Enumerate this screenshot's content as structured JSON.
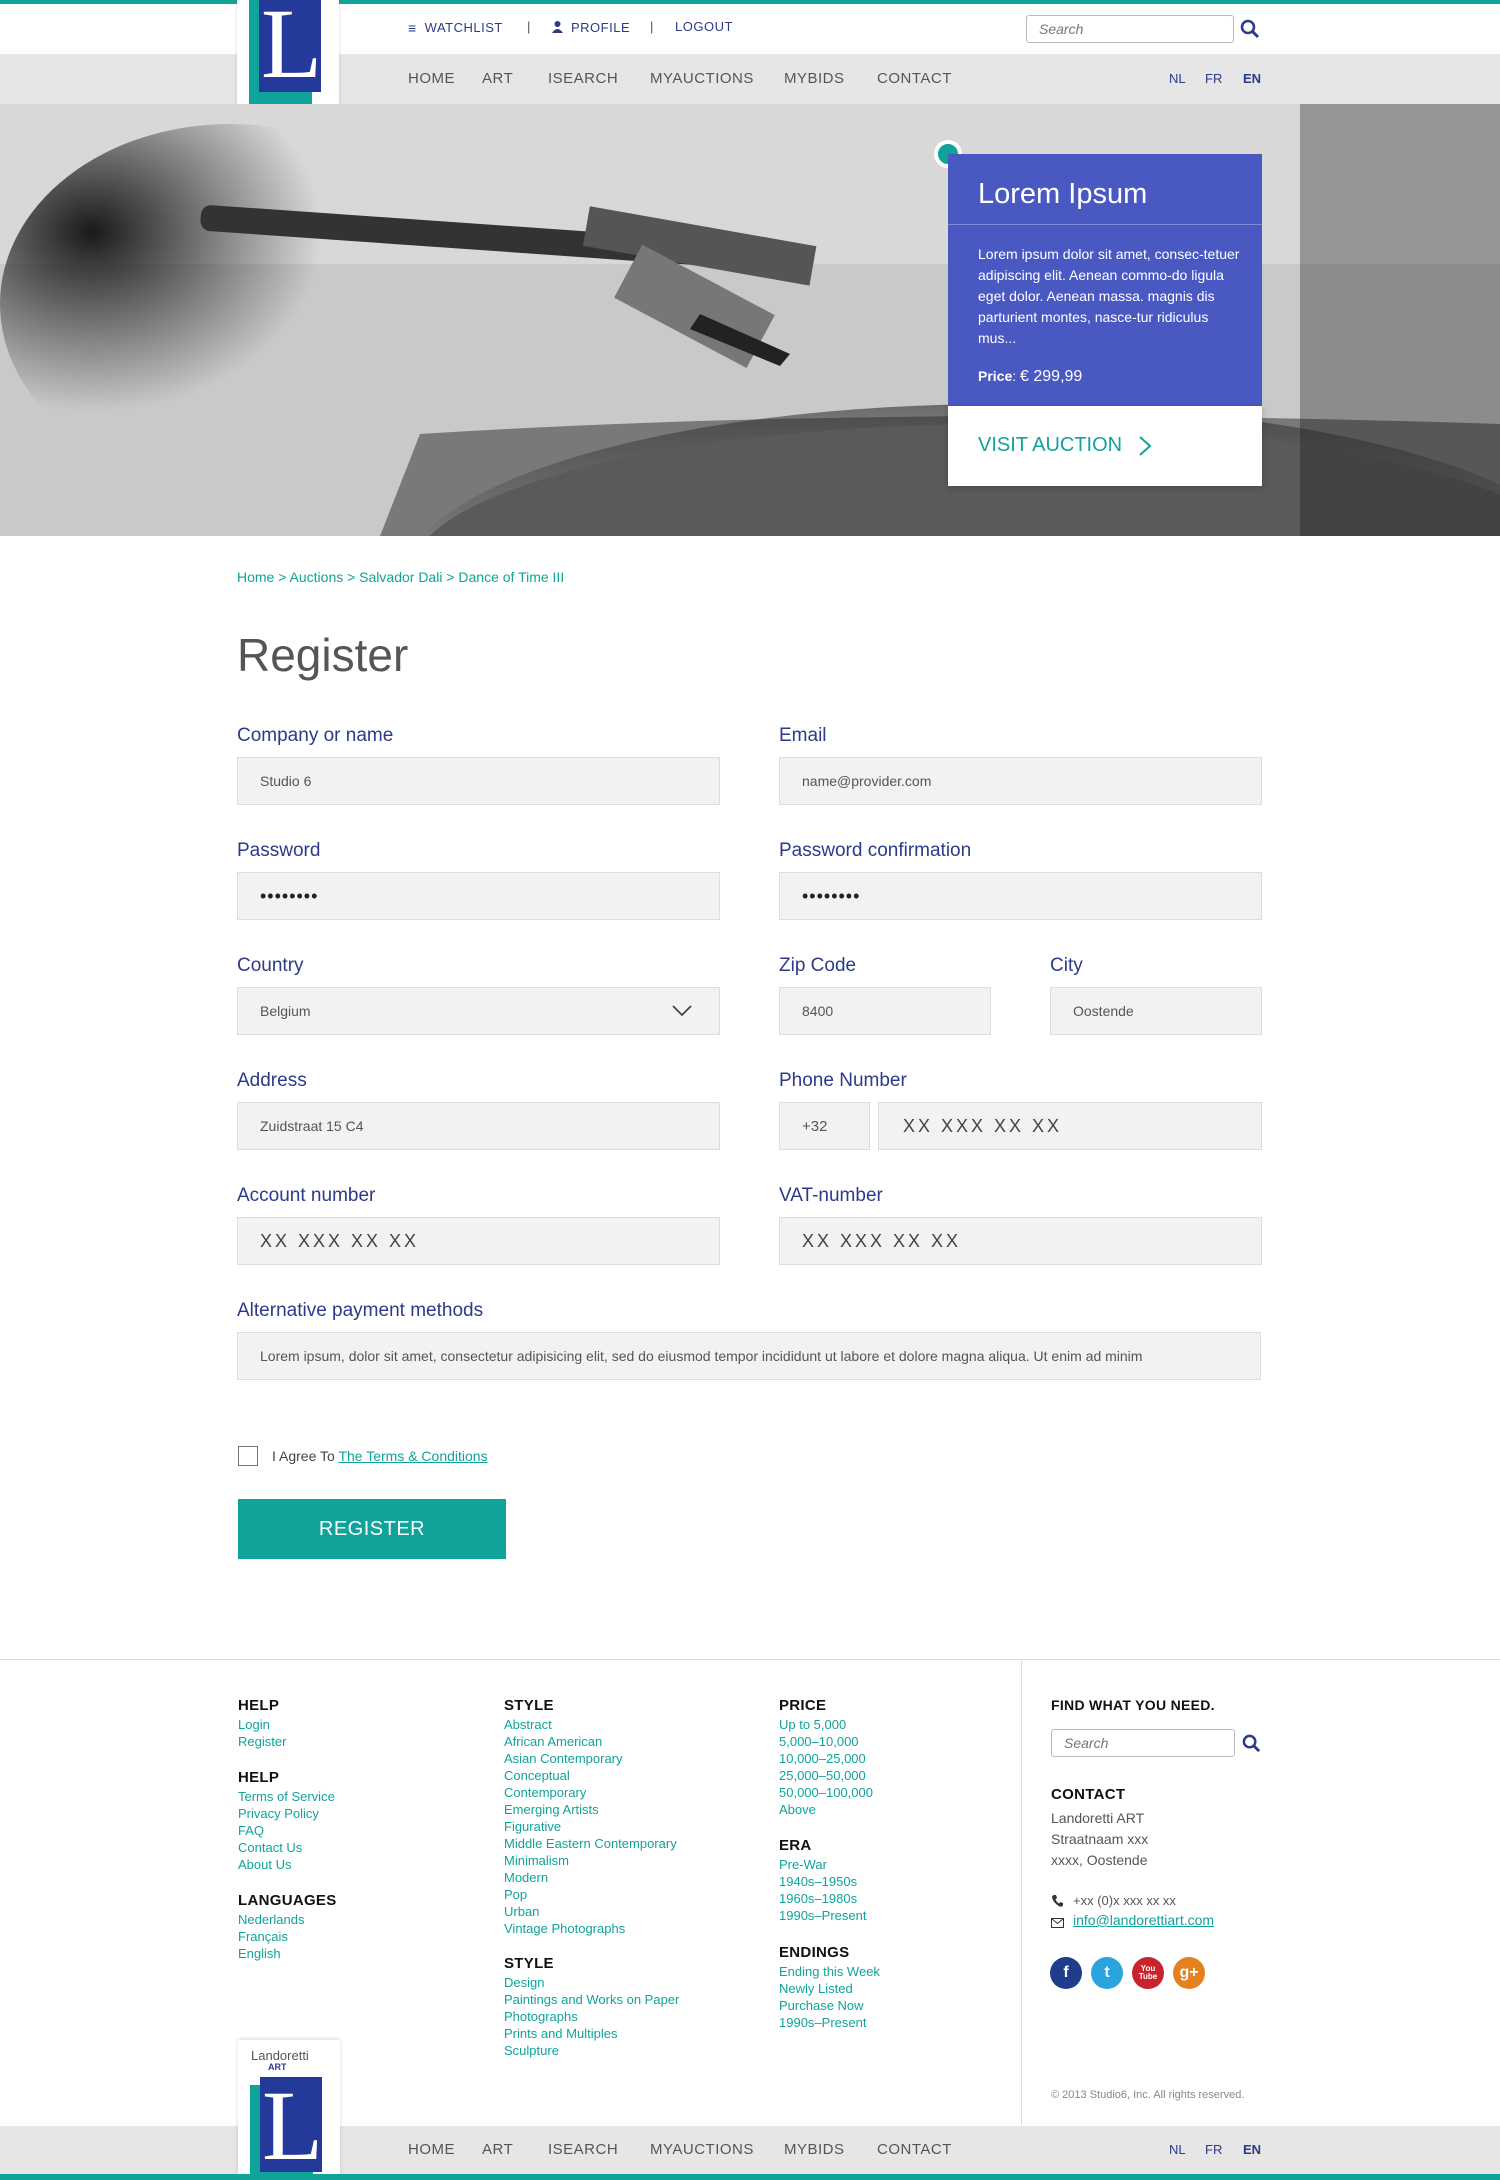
{
  "header": {
    "util": {
      "watchlist": "WATCHLIST",
      "profile": "PROFILE",
      "logout": "LOGOUT",
      "sep": "|"
    },
    "search_placeholder": "Search",
    "logo": {
      "name": "Landoretti",
      "sub": "ART",
      "letter": "L"
    },
    "nav": [
      "HOME",
      "ART",
      "ISEARCH",
      "MYAUCTIONS",
      "MYBIDS",
      "CONTACT"
    ],
    "langs": [
      "NL",
      "FR",
      "EN"
    ]
  },
  "promo": {
    "title": "Lorem Ipsum",
    "body": "Lorem ipsum dolor sit amet, consec-tetuer adipiscing elit. Aenean commo-do ligula eget dolor. Aenean massa. magnis dis parturient montes, nasce-tur ridiculus mus...",
    "price_label": "Price",
    "price": "€ 299,99",
    "cta": "VISIT AUCTION"
  },
  "breadcrumb": "Home > Auctions > Salvador Dali > Dance of Time III",
  "page_title": "Register",
  "form": {
    "company": {
      "label": "Company or name",
      "value": "Studio 6"
    },
    "email": {
      "label": "Email",
      "value": "name@provider.com"
    },
    "password": {
      "label": "Password",
      "value": "••••••••"
    },
    "password_confirm": {
      "label": "Password confirmation",
      "value": "••••••••"
    },
    "country": {
      "label": "Country",
      "value": "Belgium"
    },
    "zip": {
      "label": "Zip Code",
      "value": "8400"
    },
    "city": {
      "label": "City",
      "value": "Oostende"
    },
    "address": {
      "label": "Address",
      "value": "Zuidstraat 15 C4"
    },
    "phone": {
      "label": "Phone Number",
      "prefix": "+32",
      "value": "XX XXX XX XX"
    },
    "account": {
      "label": "Account number",
      "value": "XX XXX XX XX"
    },
    "vat": {
      "label": "VAT-number",
      "value": "XX XXX XX XX"
    },
    "alt_payment": {
      "label": "Alternative payment methods",
      "value": "Lorem ipsum, dolor sit amet, consectetur adipisicing elit, sed do eiusmod tempor incididunt ut labore et dolore magna aliqua. Ut enim ad minim"
    },
    "agree_text": "I Agree To",
    "terms_link": "The Terms & Conditions",
    "submit": "REGISTER"
  },
  "footer": {
    "col1": [
      {
        "heading": "HELP",
        "links": [
          "Login",
          "Register"
        ]
      },
      {
        "heading": "HELP",
        "links": [
          "Terms of Service",
          "Privacy Policy",
          "FAQ",
          "Contact Us",
          "About Us"
        ]
      },
      {
        "heading": "LANGUAGES",
        "links": [
          "Nederlands",
          "Français",
          "English"
        ]
      }
    ],
    "col2": [
      {
        "heading": "STYLE",
        "links": [
          "Abstract",
          "African American",
          "Asian Contemporary",
          "Conceptual",
          "Contemporary",
          "Emerging Artists",
          "Figurative",
          "Middle Eastern Contemporary",
          "Minimalism",
          "Modern",
          "Pop",
          "Urban",
          "Vintage Photographs"
        ]
      },
      {
        "heading": "STYLE",
        "links": [
          "Design",
          "Paintings and Works on Paper",
          "Photographs",
          "Prints and Multiples",
          "Sculpture"
        ]
      }
    ],
    "col3": [
      {
        "heading": "PRICE",
        "links": [
          "Up to 5,000",
          "5,000–10,000",
          "10,000–25,000",
          "25,000–50,000",
          "50,000–100,000",
          "Above"
        ]
      },
      {
        "heading": "ERA",
        "links": [
          "Pre-War",
          "1940s–1950s",
          "1960s–1980s",
          "1990s–Present"
        ]
      },
      {
        "heading": "ENDINGS",
        "links": [
          "Ending this Week",
          "Newly Listed",
          "Purchase Now",
          "1990s–Present"
        ]
      }
    ],
    "find_heading": "FIND WHAT YOU NEED.",
    "search_placeholder": "Search",
    "contact": {
      "heading": "CONTACT",
      "lines": [
        "Landoretti ART",
        "Straatnaam xxx",
        "xxxx, Oostende"
      ],
      "phone": "+xx (0)x xxx xx xx",
      "email": "info@landorettiart.com"
    },
    "social": [
      "f",
      "t",
      "You Tube",
      "g+"
    ],
    "copyright": "© 2013 Studio6, Inc. All rights reserved."
  },
  "colors": {
    "teal": "#10a39a",
    "navy": "#2c3a8a",
    "promo_blue": "#4a59c2"
  }
}
